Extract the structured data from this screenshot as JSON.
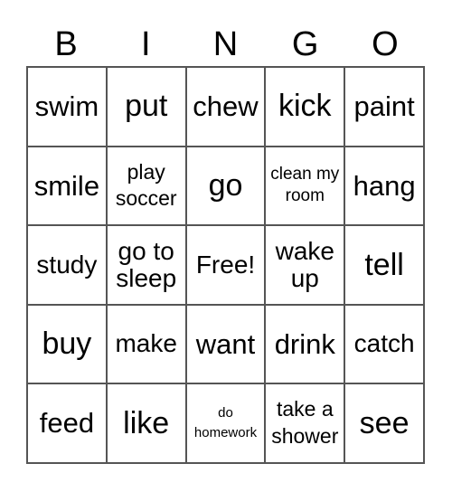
{
  "header": [
    "B",
    "I",
    "N",
    "G",
    "O"
  ],
  "cells": [
    {
      "text": "swim",
      "size": "s-l"
    },
    {
      "text": "put",
      "size": "s-xl"
    },
    {
      "text": "chew",
      "size": "s-l"
    },
    {
      "text": "kick",
      "size": "s-xl"
    },
    {
      "text": "paint",
      "size": "s-l"
    },
    {
      "text": "smile",
      "size": "s-l"
    },
    {
      "text": "play soccer",
      "size": "s-s"
    },
    {
      "text": "go",
      "size": "s-xl"
    },
    {
      "text": "clean my room",
      "size": "s-xs"
    },
    {
      "text": "hang",
      "size": "s-l"
    },
    {
      "text": "study",
      "size": "s-m"
    },
    {
      "text": "go to sleep",
      "size": "s-m"
    },
    {
      "text": "Free!",
      "size": "s-m"
    },
    {
      "text": "wake up",
      "size": "s-m"
    },
    {
      "text": "tell",
      "size": "s-xl"
    },
    {
      "text": "buy",
      "size": "s-xl"
    },
    {
      "text": "make",
      "size": "s-m"
    },
    {
      "text": "want",
      "size": "s-l"
    },
    {
      "text": "drink",
      "size": "s-l"
    },
    {
      "text": "catch",
      "size": "s-m"
    },
    {
      "text": "feed",
      "size": "s-l"
    },
    {
      "text": "like",
      "size": "s-xl"
    },
    {
      "text": "do homework",
      "size": "s-xxs"
    },
    {
      "text": "take a shower",
      "size": "s-s"
    },
    {
      "text": "see",
      "size": "s-xl"
    }
  ]
}
